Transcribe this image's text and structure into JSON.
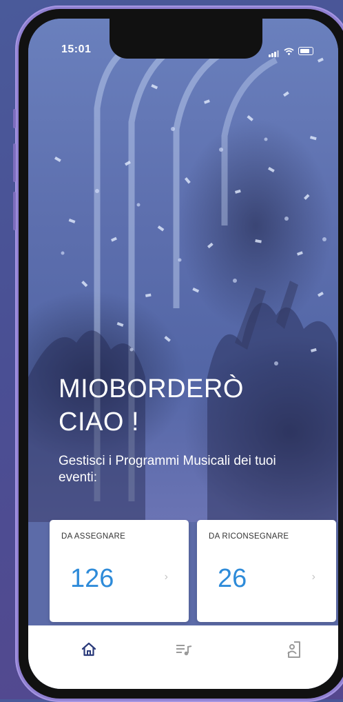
{
  "status_bar": {
    "time": "15:01",
    "icons": [
      "signal-icon",
      "wifi-icon",
      "battery-icon"
    ]
  },
  "header": {
    "title_line1": "MIOBORDERÒ",
    "title_line2": "CIAO !",
    "subtitle": "Gestisci i Programmi Musicali dei tuoi eventi:"
  },
  "cards": [
    {
      "label": "DA ASSEGNARE",
      "value": "126",
      "chevron": "›"
    },
    {
      "label": "DA RICONSEGNARE",
      "value": "26",
      "chevron": "›"
    }
  ],
  "tabs": [
    {
      "name": "home",
      "icon": "home-icon",
      "active": true
    },
    {
      "name": "programs",
      "icon": "music-list-icon",
      "active": false
    },
    {
      "name": "profile",
      "icon": "user-document-icon",
      "active": false
    }
  ],
  "colors": {
    "accent_value": "#2e8bd9",
    "active_tab": "#2a3a7a",
    "inactive_tab": "#9a9a9a",
    "card_background": "#ffffff"
  }
}
